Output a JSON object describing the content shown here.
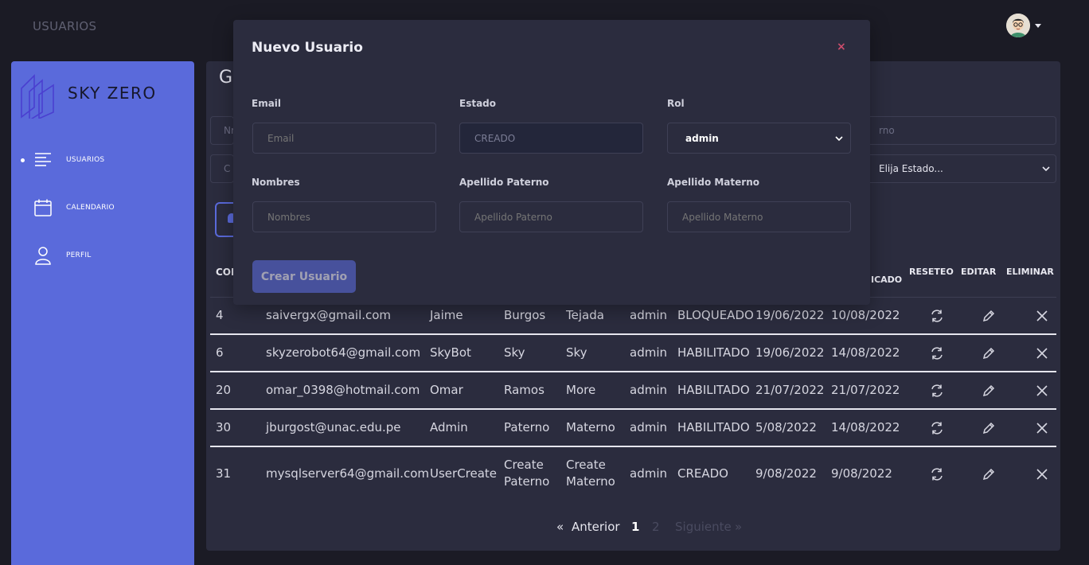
{
  "topbar": {
    "title": "USUARIOS"
  },
  "sidebar": {
    "brand": "SKY ZERO",
    "items": [
      {
        "label": "USUARIOS",
        "icon": "list-icon",
        "active": true
      },
      {
        "label": "CALENDARIO",
        "icon": "calendar-icon",
        "active": false
      },
      {
        "label": "PERFIL",
        "icon": "user-icon",
        "active": false
      }
    ]
  },
  "main": {
    "title_partial": "G",
    "filter_left1": "Nr",
    "filter_left2": "C",
    "filter_right1": "rno",
    "filter_right2": "Elija Estado..."
  },
  "table": {
    "headers": [
      "COI",
      "ICADO",
      "RESETEO",
      "EDITAR",
      "ELIMINAR"
    ],
    "rows": [
      {
        "id": "4",
        "email": "saivergx@gmail.com",
        "nombres": "Jaime",
        "paterno": "Burgos",
        "materno": "Tejada",
        "rol": "admin",
        "estado": "BLOQUEADO",
        "creado": "19/06/2022",
        "modificado": "10/08/2022"
      },
      {
        "id": "6",
        "email": "skyzerobot64@gmail.com",
        "nombres": "SkyBot",
        "paterno": "Sky",
        "materno": "Sky",
        "rol": "admin",
        "estado": "HABILITADO",
        "creado": "19/06/2022",
        "modificado": "14/08/2022"
      },
      {
        "id": "20",
        "email": "omar_0398@hotmail.com",
        "nombres": "Omar",
        "paterno": "Ramos",
        "materno": "More",
        "rol": "admin",
        "estado": "HABILITADO",
        "creado": "21/07/2022",
        "modificado": "21/07/2022"
      },
      {
        "id": "30",
        "email": "jburgost@unac.edu.pe",
        "nombres": "Admin",
        "paterno": "Paterno",
        "materno": "Materno",
        "rol": "admin",
        "estado": "HABILITADO",
        "creado": "5/08/2022",
        "modificado": "14/08/2022"
      },
      {
        "id": "31",
        "email": "mysqlserver64@gmail.com",
        "nombres": "UserCreate",
        "paterno": "Create Paterno",
        "materno": "Create Materno",
        "rol": "admin",
        "estado": "CREADO",
        "creado": "9/08/2022",
        "modificado": "9/08/2022"
      }
    ]
  },
  "pagination": {
    "prev_arrow": "«",
    "prev_label": "Anterior",
    "pages": [
      "1",
      "2"
    ],
    "next_label": "Siguiente",
    "next_arrow": "»"
  },
  "modal": {
    "title": "Nuevo Usuario",
    "close": "×",
    "fields": {
      "email": {
        "label": "Email",
        "placeholder": "Email"
      },
      "estado": {
        "label": "Estado",
        "value": "CREADO"
      },
      "rol": {
        "label": "Rol",
        "value": "admin"
      },
      "nombres": {
        "label": "Nombres",
        "placeholder": "Nombres"
      },
      "paterno": {
        "label": "Apellido Paterno",
        "placeholder": "Apellido Paterno"
      },
      "materno": {
        "label": "Apellido Materno",
        "placeholder": "Apellido Materno"
      }
    },
    "submit": "Crear Usuario"
  },
  "colors": {
    "accent": "#5a6adb",
    "background": "#1b1b25",
    "panel": "#2b2c3e",
    "close": "#cc4d6c"
  }
}
